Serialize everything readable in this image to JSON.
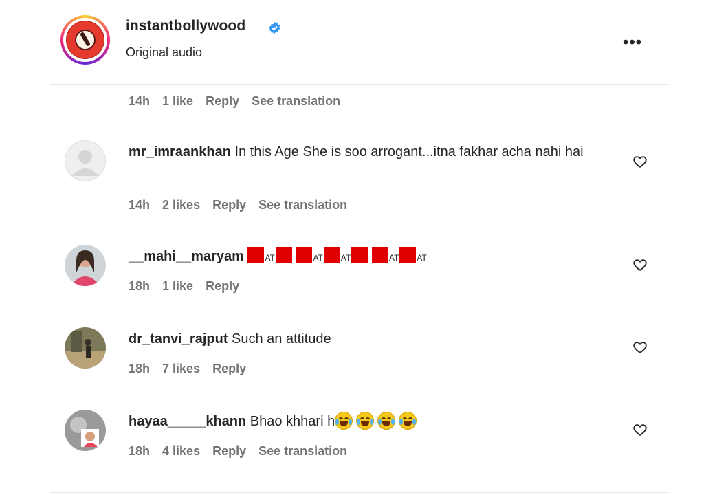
{
  "post": {
    "username": "instantbollywood",
    "subtitle": "Original audio",
    "more_label": "•••"
  },
  "first_meta": {
    "time": "14h",
    "likes": "1 like",
    "reply": "Reply",
    "translate": "See translation"
  },
  "comments": [
    {
      "username": "mr_imraankhan",
      "text": " In this Age She is soo arrogant...itna fakhar acha nahi hai",
      "time": "14h",
      "likes": "2 likes",
      "reply": "Reply",
      "translate": "See translation",
      "avatar": "default-avatar"
    },
    {
      "username": "__mahi__maryam",
      "text_at": "AT",
      "time": "18h",
      "likes": "1 like",
      "reply": "Reply",
      "avatar": "photo-avatar-pink"
    },
    {
      "username": "dr_tanvi_rajput",
      "text": " Such an attitude",
      "time": "18h",
      "likes": "7 likes",
      "reply": "Reply",
      "avatar": "photo-avatar-outdoor"
    },
    {
      "username": "hayaa_____khann",
      "text": " Bhao khhari h",
      "time": "18h",
      "likes": "4 likes",
      "reply": "Reply",
      "translate": "See translation",
      "avatar": "photo-avatar-gray"
    }
  ],
  "colors": {
    "verified": "#3897f0",
    "text": "#262626",
    "secondary": "#737373",
    "emoji_square": "#e00000"
  },
  "icons": [
    "verified-badge-icon",
    "more-options-icon",
    "heart-icon"
  ]
}
